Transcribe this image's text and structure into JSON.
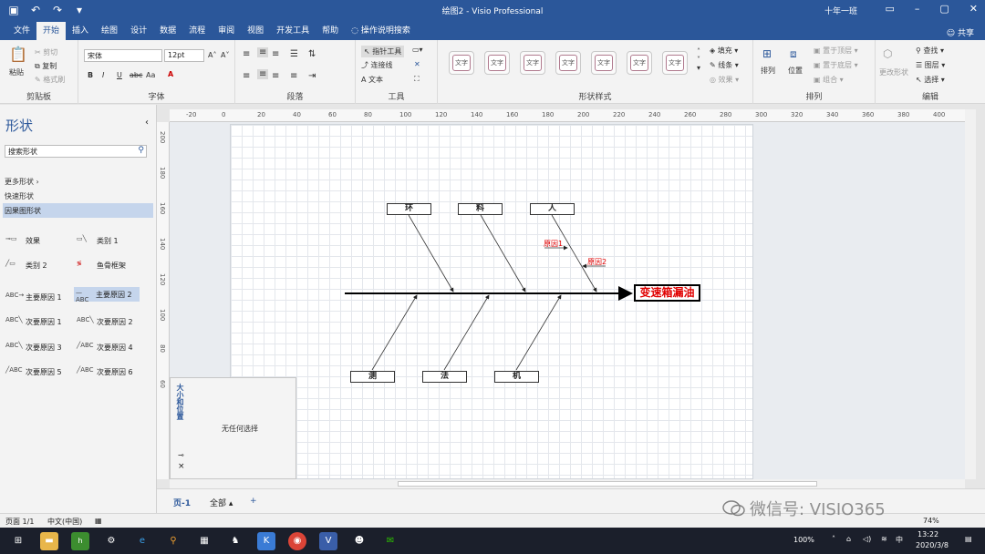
{
  "window": {
    "title": "绘图2 - Visio Professional",
    "account": "十年一班",
    "share": "共享"
  },
  "menu_tabs": [
    "文件",
    "开始",
    "插入",
    "绘图",
    "设计",
    "数据",
    "流程",
    "审阅",
    "视图",
    "开发工具",
    "帮助"
  ],
  "menu_search": "操作说明搜索",
  "ribbon": {
    "clipboard": {
      "paste": "粘贴",
      "cut": "剪切",
      "copy": "复制",
      "format_painter": "格式刷",
      "label": "剪贴板"
    },
    "font": {
      "name": "宋体",
      "size": "12pt",
      "bold": "B",
      "italic": "I",
      "underline": "U",
      "strike": "abc",
      "case": "Aa",
      "label": "字体"
    },
    "paragraph": {
      "label": "段落"
    },
    "tools": {
      "pointer": "指针工具",
      "connector": "连接线",
      "text": "文本",
      "label": "工具"
    },
    "shape_styles": {
      "swatch_text": "文字",
      "label": "形状样式",
      "fill": "填充",
      "line": "线条",
      "effects": "效果"
    },
    "arrange": {
      "arrange": "排列",
      "position": "位置",
      "bring_front": "置于顶层",
      "send_back": "置于底层",
      "group": "组合",
      "label": "排列"
    },
    "editing": {
      "change_shape": "更改形状",
      "find": "查找",
      "layers": "图层",
      "select": "选择",
      "label": "编辑"
    }
  },
  "shapes_pane": {
    "title": "形状",
    "search_placeholder": "搜索形状",
    "more_shapes": "更多形状",
    "quick_shapes": "快速形状",
    "stencil": "因果图形状",
    "items": [
      "效果",
      "类别 1",
      "类别 2",
      "鱼骨框架",
      "主要原因 1",
      "主要原因 2",
      "次要原因 1",
      "次要原因 2",
      "次要原因 3",
      "次要原因 4",
      "次要原因 5",
      "次要原因 6"
    ],
    "icon_text": {
      "primary": "ABC",
      "secondary": "ABC"
    }
  },
  "ruler_h": [
    "-20",
    "0",
    "20",
    "40",
    "60",
    "80",
    "100",
    "120",
    "140",
    "160",
    "180",
    "200",
    "220",
    "240",
    "260",
    "280",
    "300",
    "320",
    "340",
    "360",
    "380",
    "400"
  ],
  "ruler_v": [
    "200",
    "180",
    "160",
    "140",
    "120",
    "100",
    "80",
    "60"
  ],
  "diagram": {
    "effect": "变速箱漏油",
    "top_categories": [
      "环",
      "料",
      "人"
    ],
    "bottom_categories": [
      "测",
      "法",
      "机"
    ],
    "causes": [
      "原因1",
      "原因2"
    ]
  },
  "size_position": {
    "title": "大小和位置",
    "empty": "无任何选择",
    "pin_icon": "pin-icon",
    "close": "×"
  },
  "page_tabs": {
    "page": "页-1",
    "all": "全部",
    "add": "+"
  },
  "status": {
    "page": "页面 1/1",
    "language": "中文(中国)",
    "zoom": "74%"
  },
  "watermark": "微信号: VISIO365",
  "taskbar": {
    "time": "13:22",
    "date": "2020/3/8",
    "battery": "100%",
    "ime": "中"
  },
  "colors": {
    "brand": "#2b579a",
    "effect_text": "#e00000",
    "grid": "#e4e7ec"
  }
}
